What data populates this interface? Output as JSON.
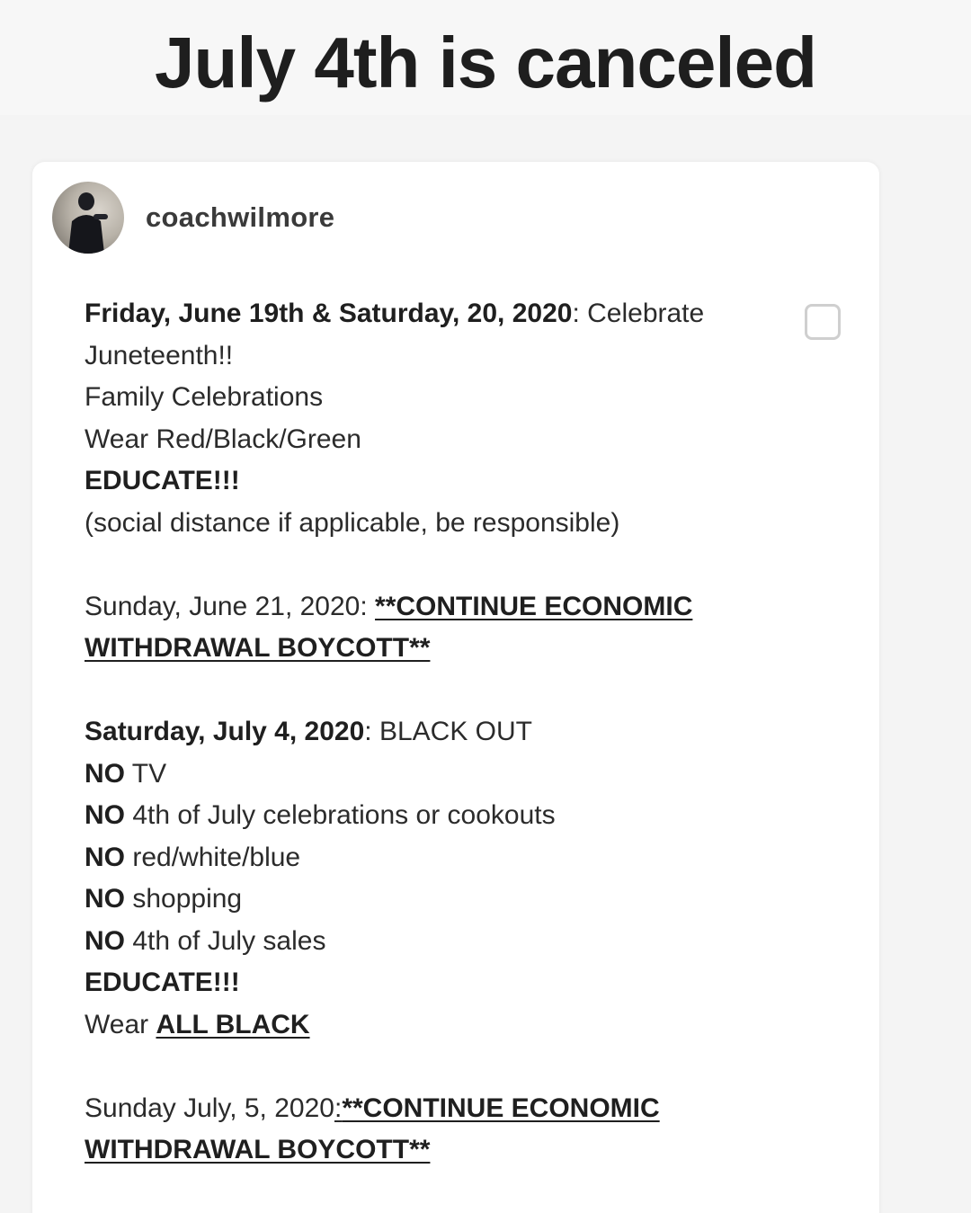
{
  "headline": "July 4th is canceled",
  "post": {
    "username": "coachwilmore",
    "juneteenth": {
      "date": "Friday, June 19th & Saturday, 20, 2020",
      "sep": ": ",
      "text": "Celebrate",
      "text2": "Juneteenth!!",
      "item1": "Family Celebrations",
      "item2": "Wear Red/Black/Green",
      "item3": "EDUCATE!!!",
      "item4": "(social distance if applicable, be responsible)"
    },
    "june21": {
      "date": "Sunday, June 21, 2020: ",
      "action1": "**CONTINUE ECONOMIC",
      "action2": "WITHDRAWAL BOYCOTT**"
    },
    "july4": {
      "date": "Saturday, July 4, 2020",
      "sep": ": ",
      "text": "BLACK OUT",
      "no_label": "NO",
      "no_items": [
        " TV",
        " 4th of July celebrations or cookouts",
        " red/white/blue",
        " shopping",
        " 4th of July sales"
      ],
      "educate": "EDUCATE!!!",
      "wear": "Wear ",
      "wear_color": "ALL BLACK"
    },
    "july5": {
      "date": "Sunday July, 5, 2020",
      "sep": ":",
      "action1": "**CONTINUE ECONOMIC",
      "action2": "WITHDRAWAL BOYCOTT**"
    }
  }
}
